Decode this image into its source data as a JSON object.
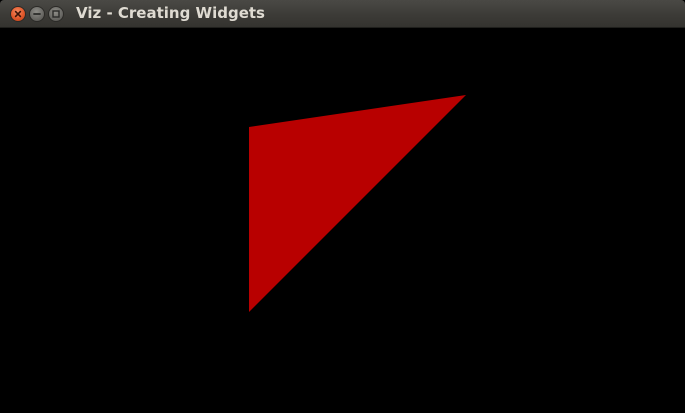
{
  "window": {
    "title": "Viz - Creating Widgets",
    "controls": {
      "close_icon": "close-icon",
      "minimize_icon": "minimize-icon",
      "maximize_icon": "maximize-icon"
    }
  },
  "scene": {
    "background_color": "#000000",
    "widget": {
      "shape": "triangle",
      "fill_color": "#b80000"
    }
  }
}
